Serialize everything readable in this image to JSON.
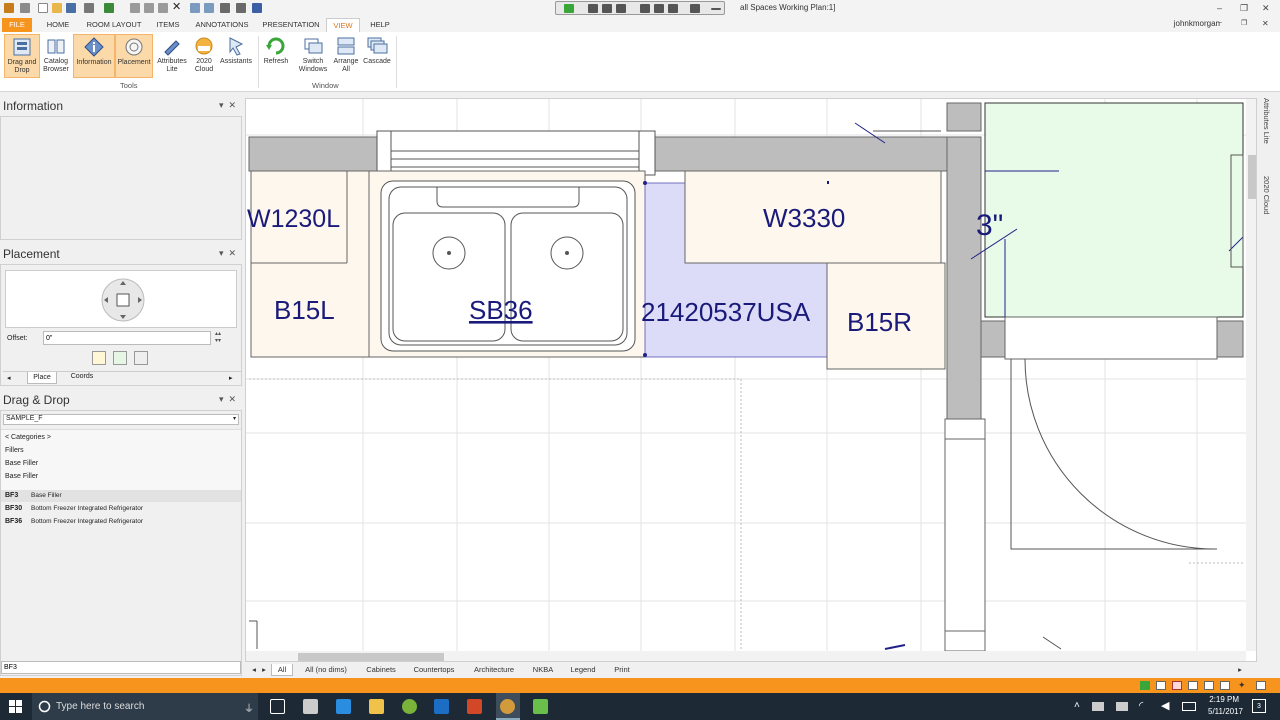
{
  "window": {
    "title": "all Spaces Working Plan:1]",
    "user": "johnkmorgan"
  },
  "ribbon_tabs": [
    "FILE",
    "HOME",
    "ROOM LAYOUT",
    "ITEMS",
    "ANNOTATIONS",
    "PRESENTATION",
    "VIEW",
    "HELP"
  ],
  "ribbon": {
    "tools": [
      {
        "label": "Drag and Drop",
        "icon": "drag-drop-icon"
      },
      {
        "label": "Catalog Browser",
        "icon": "catalog-browser-icon"
      },
      {
        "label": "Information",
        "icon": "information-icon"
      },
      {
        "label": "Placement",
        "icon": "placement-icon"
      },
      {
        "label": "Attributes Lite",
        "icon": "attributes-icon"
      },
      {
        "label": "2020 Cloud",
        "icon": "cloud-icon"
      },
      {
        "label": "Assistants",
        "icon": "assistants-icon"
      }
    ],
    "tools_group": "Tools",
    "window": [
      {
        "label": "Refresh",
        "icon": "refresh-icon"
      },
      {
        "label": "Switch Windows",
        "icon": "switch-windows-icon"
      },
      {
        "label": "Arrange All",
        "icon": "arrange-all-icon"
      },
      {
        "label": "Cascade",
        "icon": "cascade-icon"
      }
    ],
    "window_group": "Window"
  },
  "information_panel": {
    "title": "Information"
  },
  "placement_panel": {
    "title": "Placement",
    "offset_label": "Offset:",
    "offset_value": "0\"",
    "tabs": [
      "Place",
      "Coords"
    ]
  },
  "dragdrop_panel": {
    "title": "Drag & Drop",
    "catalog": "SAMPLE_F",
    "categories": "< Categories >",
    "category_items": [
      "Fillers",
      "Base Filler",
      "Base Filler"
    ],
    "items": [
      {
        "code": "BF3",
        "desc": "Base Filler"
      },
      {
        "code": "BF30",
        "desc": "Bottom Freezer Integrated Refrigerator"
      },
      {
        "code": "BF36",
        "desc": "Bottom Freezer Integrated Refrigerator"
      }
    ],
    "search_value": "BF3"
  },
  "plan_labels": {
    "w1230l": "W1230L",
    "b15l": "B15L",
    "sb36": "SB36",
    "w3330": "W3330",
    "appliance": "21420537USA",
    "b15r": "B15R",
    "dim": "3\""
  },
  "right_strip": [
    "Attributes Lite",
    "2020 Cloud"
  ],
  "bottom_tabs": [
    "All",
    "All (no dims)",
    "Cabinets",
    "Countertops",
    "Architecture",
    "NKBA",
    "Legend",
    "Print"
  ],
  "taskbar": {
    "search_placeholder": "Type here to search",
    "time": "2:19 PM",
    "date": "5/11/2017",
    "notifications": "3"
  },
  "colors": {
    "accent": "#f7941d",
    "wall": "#bdbdbd",
    "cabinet": "#fdf7ee",
    "appliance": "#dcdcf8",
    "room": "#e6fbe6",
    "label": "#1a1a7a"
  }
}
